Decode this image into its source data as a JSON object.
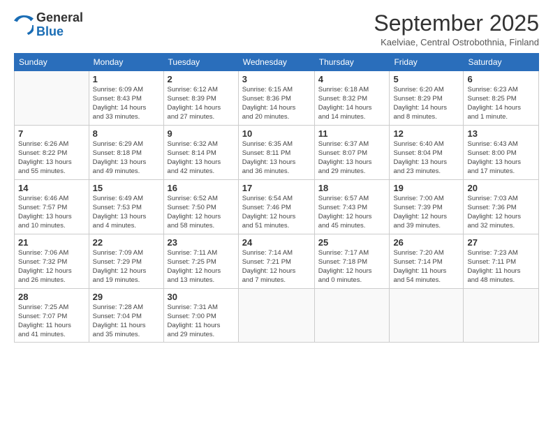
{
  "header": {
    "logo_general": "General",
    "logo_blue": "Blue",
    "month": "September 2025",
    "location": "Kaelviae, Central Ostrobothnia, Finland"
  },
  "days_of_week": [
    "Sunday",
    "Monday",
    "Tuesday",
    "Wednesday",
    "Thursday",
    "Friday",
    "Saturday"
  ],
  "weeks": [
    [
      {
        "day": "",
        "info": ""
      },
      {
        "day": "1",
        "info": "Sunrise: 6:09 AM\nSunset: 8:43 PM\nDaylight: 14 hours\nand 33 minutes."
      },
      {
        "day": "2",
        "info": "Sunrise: 6:12 AM\nSunset: 8:39 PM\nDaylight: 14 hours\nand 27 minutes."
      },
      {
        "day": "3",
        "info": "Sunrise: 6:15 AM\nSunset: 8:36 PM\nDaylight: 14 hours\nand 20 minutes."
      },
      {
        "day": "4",
        "info": "Sunrise: 6:18 AM\nSunset: 8:32 PM\nDaylight: 14 hours\nand 14 minutes."
      },
      {
        "day": "5",
        "info": "Sunrise: 6:20 AM\nSunset: 8:29 PM\nDaylight: 14 hours\nand 8 minutes."
      },
      {
        "day": "6",
        "info": "Sunrise: 6:23 AM\nSunset: 8:25 PM\nDaylight: 14 hours\nand 1 minute."
      }
    ],
    [
      {
        "day": "7",
        "info": "Sunrise: 6:26 AM\nSunset: 8:22 PM\nDaylight: 13 hours\nand 55 minutes."
      },
      {
        "day": "8",
        "info": "Sunrise: 6:29 AM\nSunset: 8:18 PM\nDaylight: 13 hours\nand 49 minutes."
      },
      {
        "day": "9",
        "info": "Sunrise: 6:32 AM\nSunset: 8:14 PM\nDaylight: 13 hours\nand 42 minutes."
      },
      {
        "day": "10",
        "info": "Sunrise: 6:35 AM\nSunset: 8:11 PM\nDaylight: 13 hours\nand 36 minutes."
      },
      {
        "day": "11",
        "info": "Sunrise: 6:37 AM\nSunset: 8:07 PM\nDaylight: 13 hours\nand 29 minutes."
      },
      {
        "day": "12",
        "info": "Sunrise: 6:40 AM\nSunset: 8:04 PM\nDaylight: 13 hours\nand 23 minutes."
      },
      {
        "day": "13",
        "info": "Sunrise: 6:43 AM\nSunset: 8:00 PM\nDaylight: 13 hours\nand 17 minutes."
      }
    ],
    [
      {
        "day": "14",
        "info": "Sunrise: 6:46 AM\nSunset: 7:57 PM\nDaylight: 13 hours\nand 10 minutes."
      },
      {
        "day": "15",
        "info": "Sunrise: 6:49 AM\nSunset: 7:53 PM\nDaylight: 13 hours\nand 4 minutes."
      },
      {
        "day": "16",
        "info": "Sunrise: 6:52 AM\nSunset: 7:50 PM\nDaylight: 12 hours\nand 58 minutes."
      },
      {
        "day": "17",
        "info": "Sunrise: 6:54 AM\nSunset: 7:46 PM\nDaylight: 12 hours\nand 51 minutes."
      },
      {
        "day": "18",
        "info": "Sunrise: 6:57 AM\nSunset: 7:43 PM\nDaylight: 12 hours\nand 45 minutes."
      },
      {
        "day": "19",
        "info": "Sunrise: 7:00 AM\nSunset: 7:39 PM\nDaylight: 12 hours\nand 39 minutes."
      },
      {
        "day": "20",
        "info": "Sunrise: 7:03 AM\nSunset: 7:36 PM\nDaylight: 12 hours\nand 32 minutes."
      }
    ],
    [
      {
        "day": "21",
        "info": "Sunrise: 7:06 AM\nSunset: 7:32 PM\nDaylight: 12 hours\nand 26 minutes."
      },
      {
        "day": "22",
        "info": "Sunrise: 7:09 AM\nSunset: 7:29 PM\nDaylight: 12 hours\nand 19 minutes."
      },
      {
        "day": "23",
        "info": "Sunrise: 7:11 AM\nSunset: 7:25 PM\nDaylight: 12 hours\nand 13 minutes."
      },
      {
        "day": "24",
        "info": "Sunrise: 7:14 AM\nSunset: 7:21 PM\nDaylight: 12 hours\nand 7 minutes."
      },
      {
        "day": "25",
        "info": "Sunrise: 7:17 AM\nSunset: 7:18 PM\nDaylight: 12 hours\nand 0 minutes."
      },
      {
        "day": "26",
        "info": "Sunrise: 7:20 AM\nSunset: 7:14 PM\nDaylight: 11 hours\nand 54 minutes."
      },
      {
        "day": "27",
        "info": "Sunrise: 7:23 AM\nSunset: 7:11 PM\nDaylight: 11 hours\nand 48 minutes."
      }
    ],
    [
      {
        "day": "28",
        "info": "Sunrise: 7:25 AM\nSunset: 7:07 PM\nDaylight: 11 hours\nand 41 minutes."
      },
      {
        "day": "29",
        "info": "Sunrise: 7:28 AM\nSunset: 7:04 PM\nDaylight: 11 hours\nand 35 minutes."
      },
      {
        "day": "30",
        "info": "Sunrise: 7:31 AM\nSunset: 7:00 PM\nDaylight: 11 hours\nand 29 minutes."
      },
      {
        "day": "",
        "info": ""
      },
      {
        "day": "",
        "info": ""
      },
      {
        "day": "",
        "info": ""
      },
      {
        "day": "",
        "info": ""
      }
    ]
  ]
}
